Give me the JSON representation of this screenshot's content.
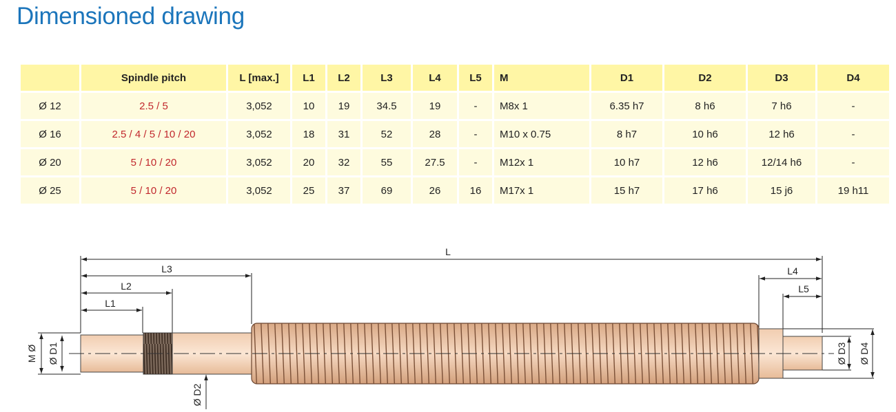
{
  "page": {
    "title": "Dimensioned drawing"
  },
  "table": {
    "headers": [
      "",
      "Spindle pitch",
      "L [max.]",
      "L1",
      "L2",
      "L3",
      "L4",
      "L5",
      "M",
      "D1",
      "D2",
      "D3",
      "D4"
    ],
    "rows": [
      [
        "Ø 12",
        "2.5 / 5",
        "3,052",
        "10",
        "19",
        "34.5",
        "19",
        "-",
        "M8x 1",
        "6.35 h7",
        "8 h6",
        "7 h6",
        "-"
      ],
      [
        "Ø 16",
        "2.5 / 4 / 5 / 10 / 20",
        "3,052",
        "18",
        "31",
        "52",
        "28",
        "-",
        "M10 x 0.75",
        "8 h7",
        "10 h6",
        "12 h6",
        "-"
      ],
      [
        "Ø 20",
        "5 / 10 / 20",
        "3,052",
        "20",
        "32",
        "55",
        "27.5",
        "-",
        "M12x 1",
        "10 h7",
        "12 h6",
        "12/14 h6",
        "-"
      ],
      [
        "Ø 25",
        "5 / 10 / 20",
        "3,052",
        "25",
        "37",
        "69",
        "26",
        "16",
        "M17x 1",
        "15 h7",
        "17 h6",
        "15 j6",
        "19 h11"
      ]
    ]
  },
  "drawing": {
    "labels": {
      "L": "L",
      "L1": "L1",
      "L2": "L2",
      "L3": "L3",
      "L4": "L4",
      "L5": "L5",
      "M": "M Ø",
      "D1": "Ø D1",
      "D2": "Ø D2",
      "D3": "Ø D3",
      "D4": "Ø D4"
    },
    "colors": {
      "shaft_light": "#f8dcc6",
      "shaft_mid": "#eabf9c",
      "thread": "#c99a78",
      "line": "#222222",
      "title": "#1b75bb",
      "header": "#fff6a5",
      "cell": "#fefbde",
      "pitch": "#c1272d"
    }
  }
}
